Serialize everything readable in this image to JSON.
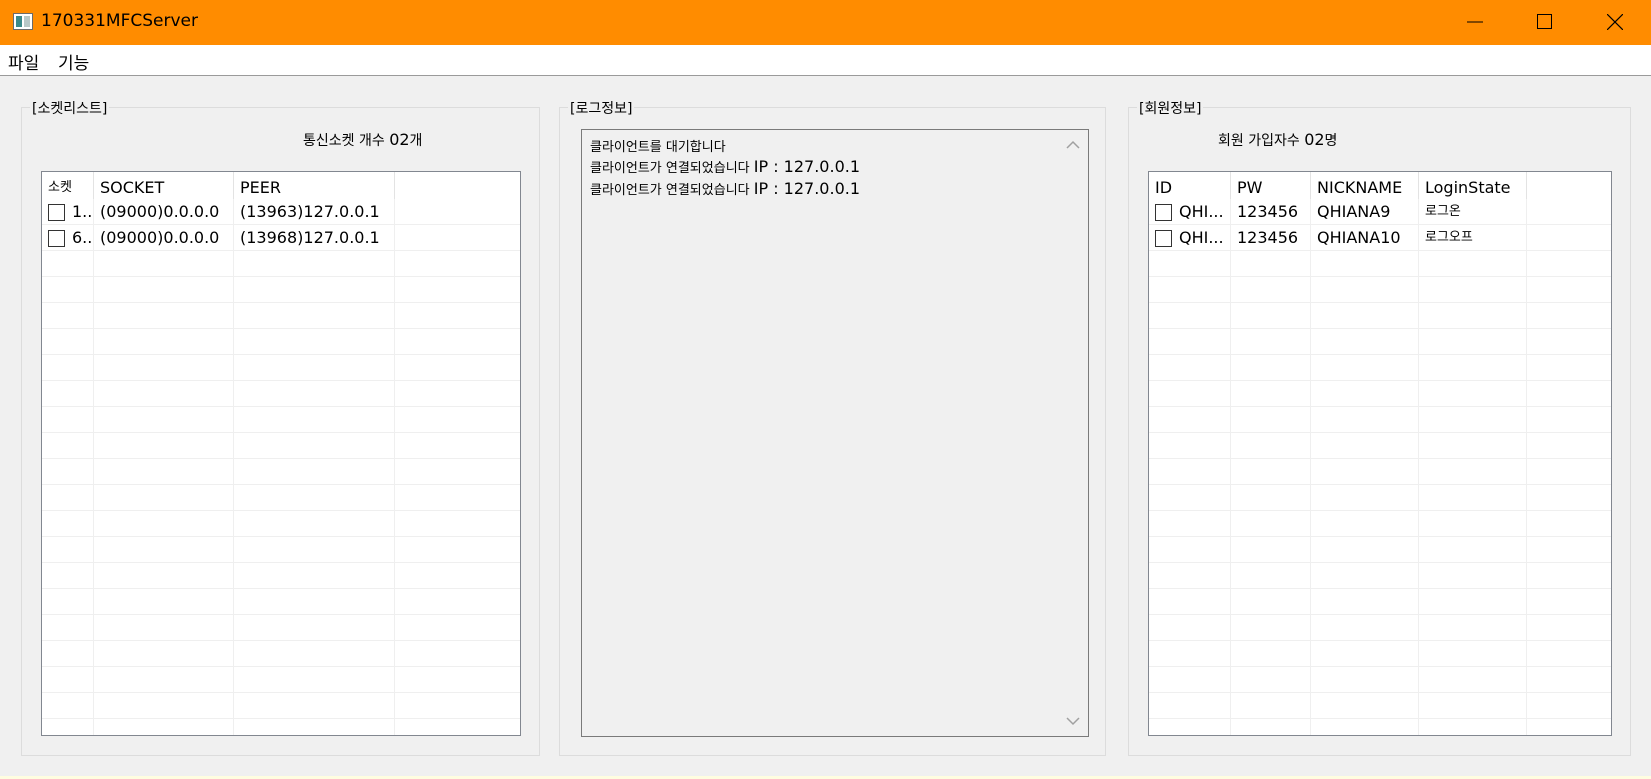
{
  "window": {
    "title": "170331MFCServer",
    "accent": "#ff8c00"
  },
  "menu": {
    "items": [
      "파일",
      "기능"
    ]
  },
  "socket_panel": {
    "legend": "[소켓리스트]",
    "count_prefix": "통신소켓 개수 ",
    "count_value": "02",
    "count_suffix": "개",
    "columns": [
      "소켓",
      "SOCKET",
      "PEER"
    ],
    "rows": [
      {
        "id": "1..",
        "socket": "(09000)0.0.0.0",
        "peer": "(13963)127.0.0.1"
      },
      {
        "id": "6..",
        "socket": "(09000)0.0.0.0",
        "peer": "(13968)127.0.0.1"
      }
    ]
  },
  "log_panel": {
    "legend": "[로그정보]",
    "lines": [
      {
        "text": "클라이언트를 대기합니다",
        "ip": ""
      },
      {
        "text": "클라이언트가 연결되었습니다 ",
        "ip": "IP : 127.0.0.1"
      },
      {
        "text": "클라이언트가 연결되었습니다 ",
        "ip": "IP : 127.0.0.1"
      }
    ]
  },
  "member_panel": {
    "legend": "[회원정보]",
    "count_prefix": "회원 가입자수 ",
    "count_value": "02",
    "count_suffix": "명",
    "columns": [
      "ID",
      "PW",
      "NICKNAME",
      "LoginState"
    ],
    "rows": [
      {
        "id": "QHI...",
        "pw": "123456",
        "nickname": "QHIANA9",
        "state": "로그온"
      },
      {
        "id": "QHI...",
        "pw": "123456",
        "nickname": "QHIANA10",
        "state": "로그오프"
      }
    ]
  }
}
